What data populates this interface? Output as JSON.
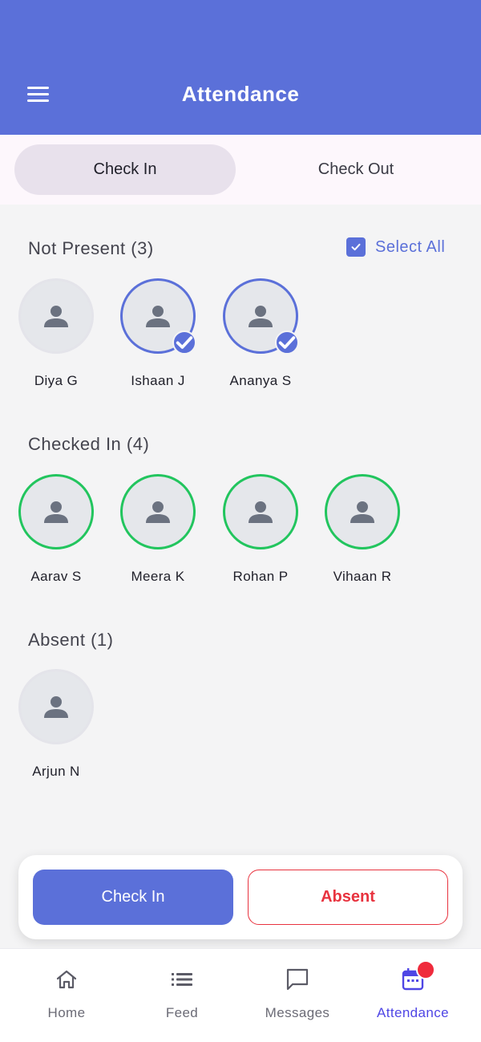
{
  "header": {
    "title": "Attendance"
  },
  "tabs": [
    {
      "label": "Check In"
    },
    {
      "label": "Check Out"
    }
  ],
  "sections": {
    "not_present": {
      "title": "Not Present (3)",
      "students": [
        {
          "name": "Diya G",
          "selected": false
        },
        {
          "name": "Ishaan J",
          "selected": true
        },
        {
          "name": "Ananya S",
          "selected": true
        }
      ]
    },
    "checked_in": {
      "title": "Checked In (4)",
      "students": [
        {
          "name": "Aarav S"
        },
        {
          "name": "Meera K"
        },
        {
          "name": "Rohan P"
        },
        {
          "name": "Vihaan R"
        }
      ]
    },
    "absent": {
      "title": "Absent (1)",
      "students": [
        {
          "name": "Arjun N"
        }
      ]
    }
  },
  "select_all": {
    "label": "Select All",
    "checked": true
  },
  "actions": {
    "check_in": "Check In",
    "absent": "Absent"
  },
  "nav": [
    {
      "label": "Home",
      "icon": "home-icon"
    },
    {
      "label": "Feed",
      "icon": "list-icon"
    },
    {
      "label": "Messages",
      "icon": "message-icon"
    },
    {
      "label": "Attendance",
      "icon": "calendar-icon",
      "active": true
    }
  ],
  "colors": {
    "primary": "#5b70d9",
    "checked": "#22c55e",
    "absent": "#e8333f",
    "nav_active": "#4f46e5"
  }
}
